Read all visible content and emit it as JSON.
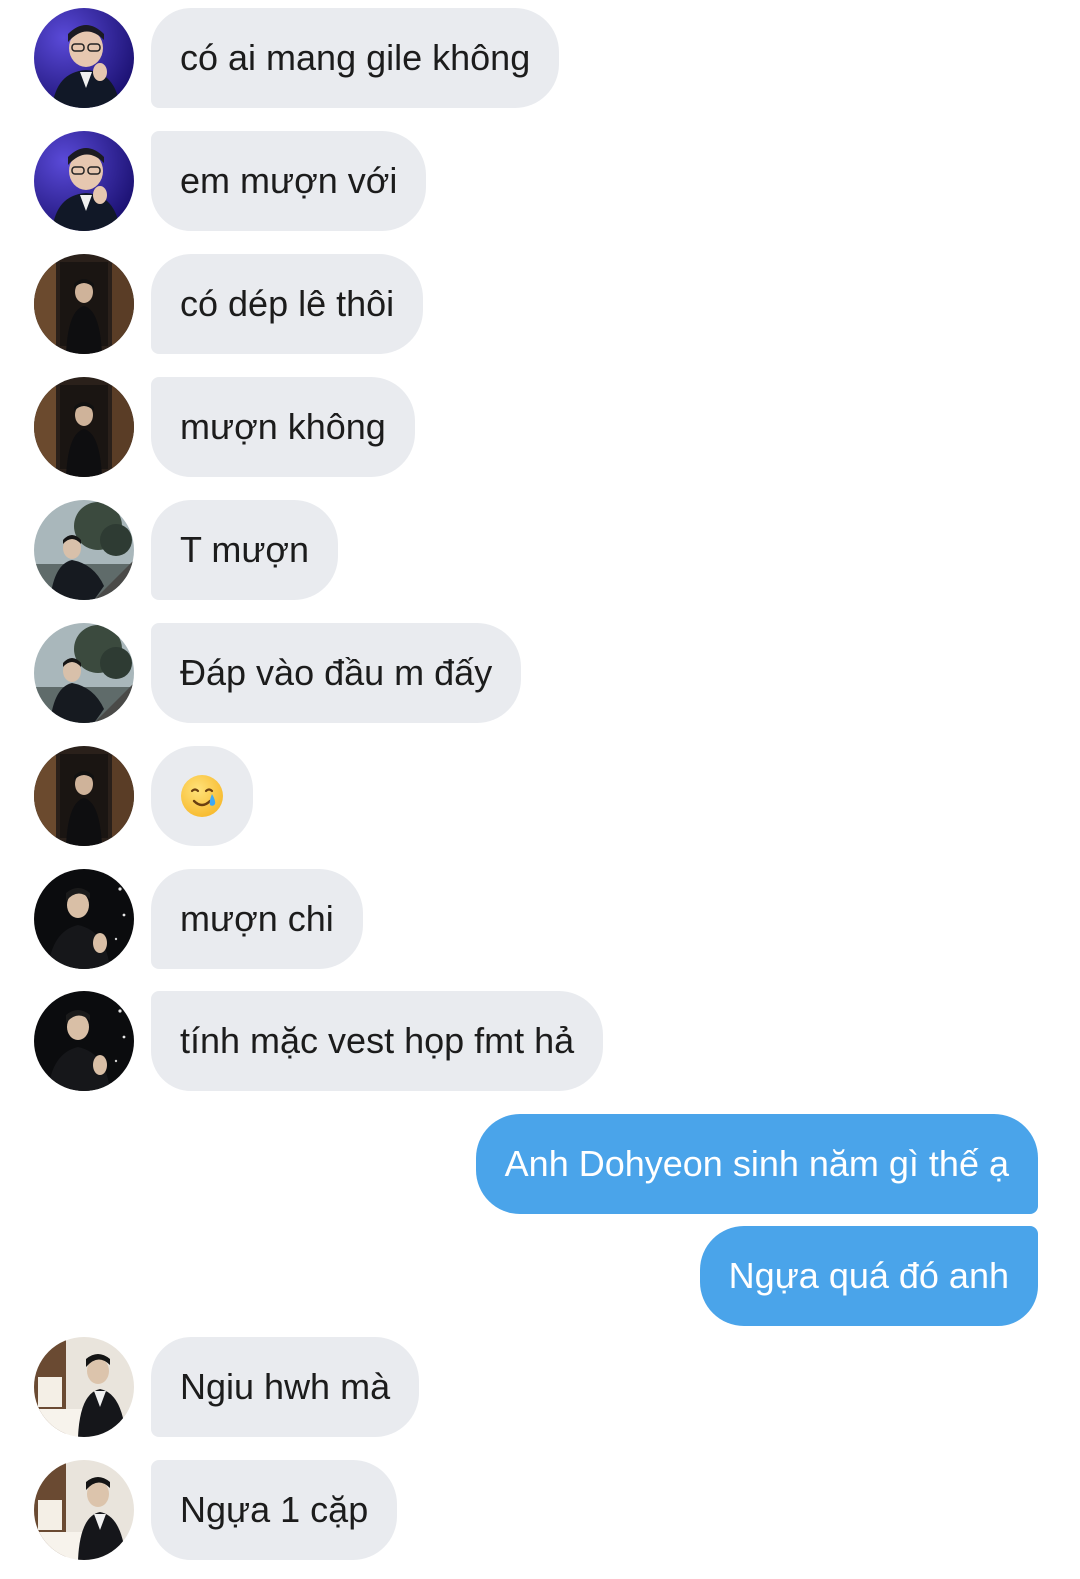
{
  "messages": [
    {
      "dir": "in",
      "avatar": "avatar-purple-glasses",
      "text": "có ai mang gile không"
    },
    {
      "dir": "in",
      "avatar": "avatar-purple-glasses",
      "text": "em mượn với"
    },
    {
      "dir": "in",
      "avatar": "avatar-dark-room",
      "text": "có dép lê thôi"
    },
    {
      "dir": "in",
      "avatar": "avatar-dark-room",
      "text": "mượn không"
    },
    {
      "dir": "in",
      "avatar": "avatar-outdoor-tree",
      "text": "T mượn"
    },
    {
      "dir": "in",
      "avatar": "avatar-outdoor-tree",
      "text": "Đáp vào đầu m đấy"
    },
    {
      "dir": "in",
      "avatar": "avatar-dark-room",
      "text": "",
      "emoji": "smiling-face-with-tear-emoji"
    },
    {
      "dir": "in",
      "avatar": "avatar-black-suit",
      "text": "mượn chi"
    },
    {
      "dir": "in",
      "avatar": "avatar-black-suit",
      "text": "tính mặc vest họp fmt hả"
    },
    {
      "dir": "out",
      "text": "Anh Dohyeon sinh năm gì thế ạ"
    },
    {
      "dir": "out",
      "text": "Ngựa quá đó anh"
    },
    {
      "dir": "in",
      "avatar": "avatar-piano-room",
      "text": "Ngiu hwh mà"
    },
    {
      "dir": "in",
      "avatar": "avatar-piano-room",
      "text": "Ngựa 1 cặp"
    }
  ],
  "colors": {
    "incoming_bubble": "#e9ebef",
    "outgoing_bubble": "#4aa4ea",
    "incoming_text": "#1c1c1c",
    "outgoing_text": "#ffffff"
  }
}
